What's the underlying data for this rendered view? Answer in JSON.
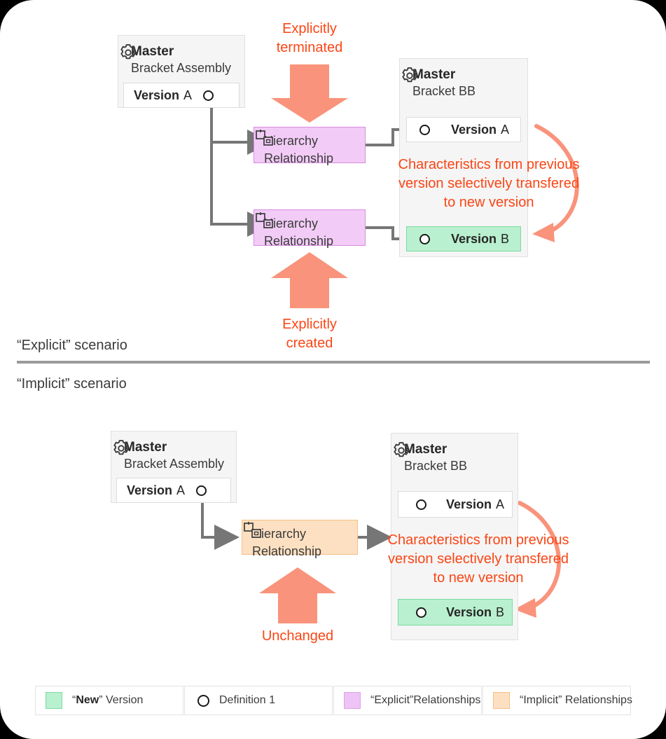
{
  "explicit": {
    "scenario_label": "“Explicit” scenario",
    "left_master": {
      "title": "Master",
      "subtitle": "Bracket Assembly",
      "gear_icon": "gear-icon",
      "version": {
        "word": "Version",
        "letter": "A"
      }
    },
    "relationships": [
      {
        "line1": "Hierarchy",
        "line2": "Relationship",
        "icon": "relationship-icon"
      },
      {
        "line1": "Hierarchy",
        "line2": "Relationship",
        "icon": "relationship-icon"
      }
    ],
    "right_master": {
      "title": "Master",
      "subtitle": "Bracket BB",
      "gear_icon": "gear-icon",
      "version_a": {
        "word": "Version",
        "letter": "A"
      },
      "version_b": {
        "word": "Version",
        "letter": "B"
      },
      "note": "Characteristics from previous version selectively transfered to new version"
    },
    "top_arrow": {
      "line1": "Explicitly",
      "line2": "terminated",
      "direction": "down"
    },
    "bottom_arrow": {
      "line1": "Explicitly",
      "line2": "created",
      "direction": "up"
    }
  },
  "implicit": {
    "scenario_label": "“Implicit” scenario",
    "left_master": {
      "title": "Master",
      "subtitle": "Bracket Assembly",
      "gear_icon": "gear-icon",
      "version": {
        "word": "Version",
        "letter": "A"
      }
    },
    "relationship": {
      "line1": "Hierarchy",
      "line2": "Relationship",
      "icon": "relationship-icon"
    },
    "right_master": {
      "title": "Master",
      "subtitle": "Bracket BB",
      "gear_icon": "gear-icon",
      "version_a": {
        "word": "Version",
        "letter": "A"
      },
      "version_b": {
        "word": "Version",
        "letter": "B"
      },
      "note": "Characteristics from previous version selectively transfered to new version"
    },
    "arrow": {
      "label": "Unchanged",
      "direction": "up"
    }
  },
  "legend": [
    {
      "type": "swatch",
      "color": "#b9f0cf",
      "border": "#7ddaa2",
      "text_pre": "“",
      "text_bold": "New",
      "text_post": "” Version"
    },
    {
      "type": "dot",
      "text": "Definition 1"
    },
    {
      "type": "swatch",
      "color": "#eec3f5",
      "border": "#dba4e6",
      "text": "“Explicit”Relationships"
    },
    {
      "type": "swatch",
      "color": "#fde0c2",
      "border": "#f5bf85",
      "text": "“Implicit” Relationships"
    }
  ],
  "colors": {
    "accent_red": "#fa4616",
    "arrow_salmon": "#f9937b",
    "connector_gray": "#767676",
    "new_version_green": "#b9f0cf",
    "explicit_purple": "#f2ccf7",
    "implicit_orange": "#fde0c2"
  }
}
